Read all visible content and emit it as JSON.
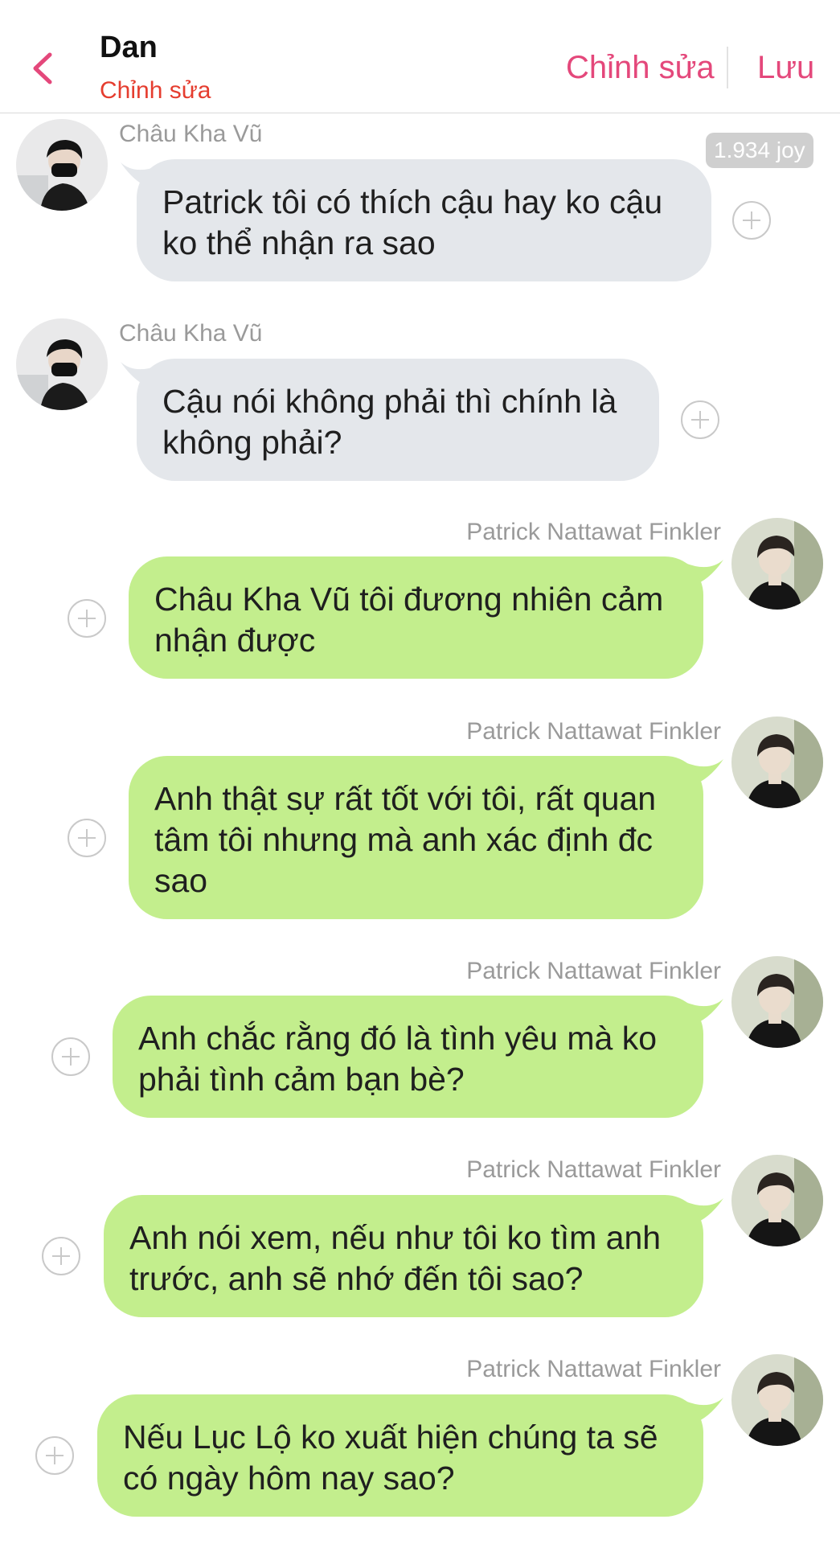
{
  "header": {
    "title": "Dan",
    "subtitle": "Chỉnh sửa",
    "edit_label": "Chỉnh sửa",
    "save_label": "Lưu"
  },
  "joy_badge": "1.934 joy",
  "messages": [
    {
      "side": "left",
      "sender": "Châu Kha Vũ",
      "text": "Patrick tôi có thích cậu hay ko cậu ko thể nhận ra sao"
    },
    {
      "side": "left",
      "sender": "Châu Kha Vũ",
      "text": "Cậu nói không phải thì chính là không phải?"
    },
    {
      "side": "right",
      "sender": "Patrick Nattawat Finkler",
      "text": "Châu Kha Vũ tôi đương nhiên cảm nhận được"
    },
    {
      "side": "right",
      "sender": "Patrick Nattawat Finkler",
      "text": "Anh thật sự rất tốt với tôi, rất quan tâm tôi nhưng mà anh xác định đc sao"
    },
    {
      "side": "right",
      "sender": "Patrick Nattawat Finkler",
      "text": "Anh chắc rằng đó là tình yêu mà ko phải tình cảm bạn bè?"
    },
    {
      "side": "right",
      "sender": "Patrick Nattawat Finkler",
      "text": "Anh nói xem, nếu như tôi ko tìm anh trước, anh sẽ nhớ đến tôi sao?"
    },
    {
      "side": "right",
      "sender": "Patrick Nattawat Finkler",
      "text": "Nếu Lục Lộ ko xuất hiện chúng ta sẽ có ngày hôm nay sao?"
    }
  ],
  "colors": {
    "accent": "#e4487b",
    "subtitle": "#e53d2f",
    "bubble_left": "#e4e7eb",
    "bubble_right": "#c3ee8d"
  },
  "icons": {
    "back": "chevron-left-icon",
    "add": "plus-circle-icon"
  }
}
